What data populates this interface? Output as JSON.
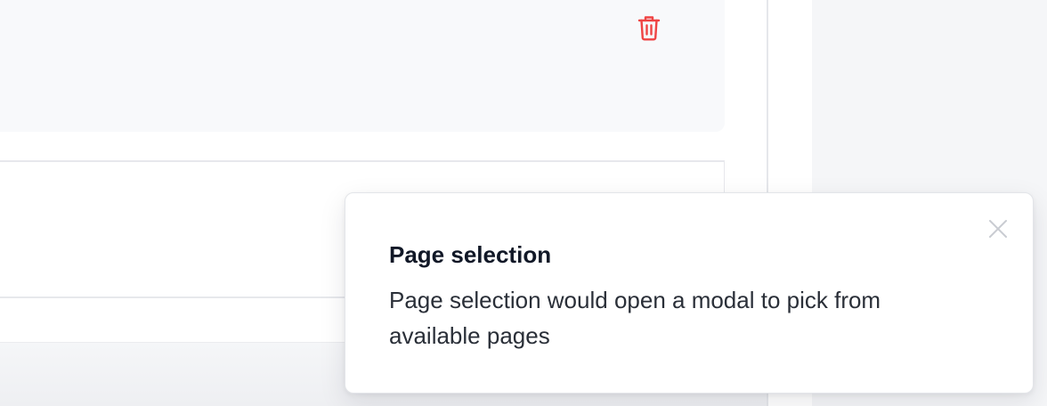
{
  "icons": {
    "delete": "trash-icon",
    "close": "close-icon"
  },
  "colors": {
    "delete_icon": "#ef4444",
    "close_icon": "#c9ccd2",
    "card_background": "#f8f9fb",
    "panel_background": "#f5f6f8"
  },
  "toast": {
    "title": "Page selection",
    "message": "Page selection would open a modal to pick from available pages"
  }
}
